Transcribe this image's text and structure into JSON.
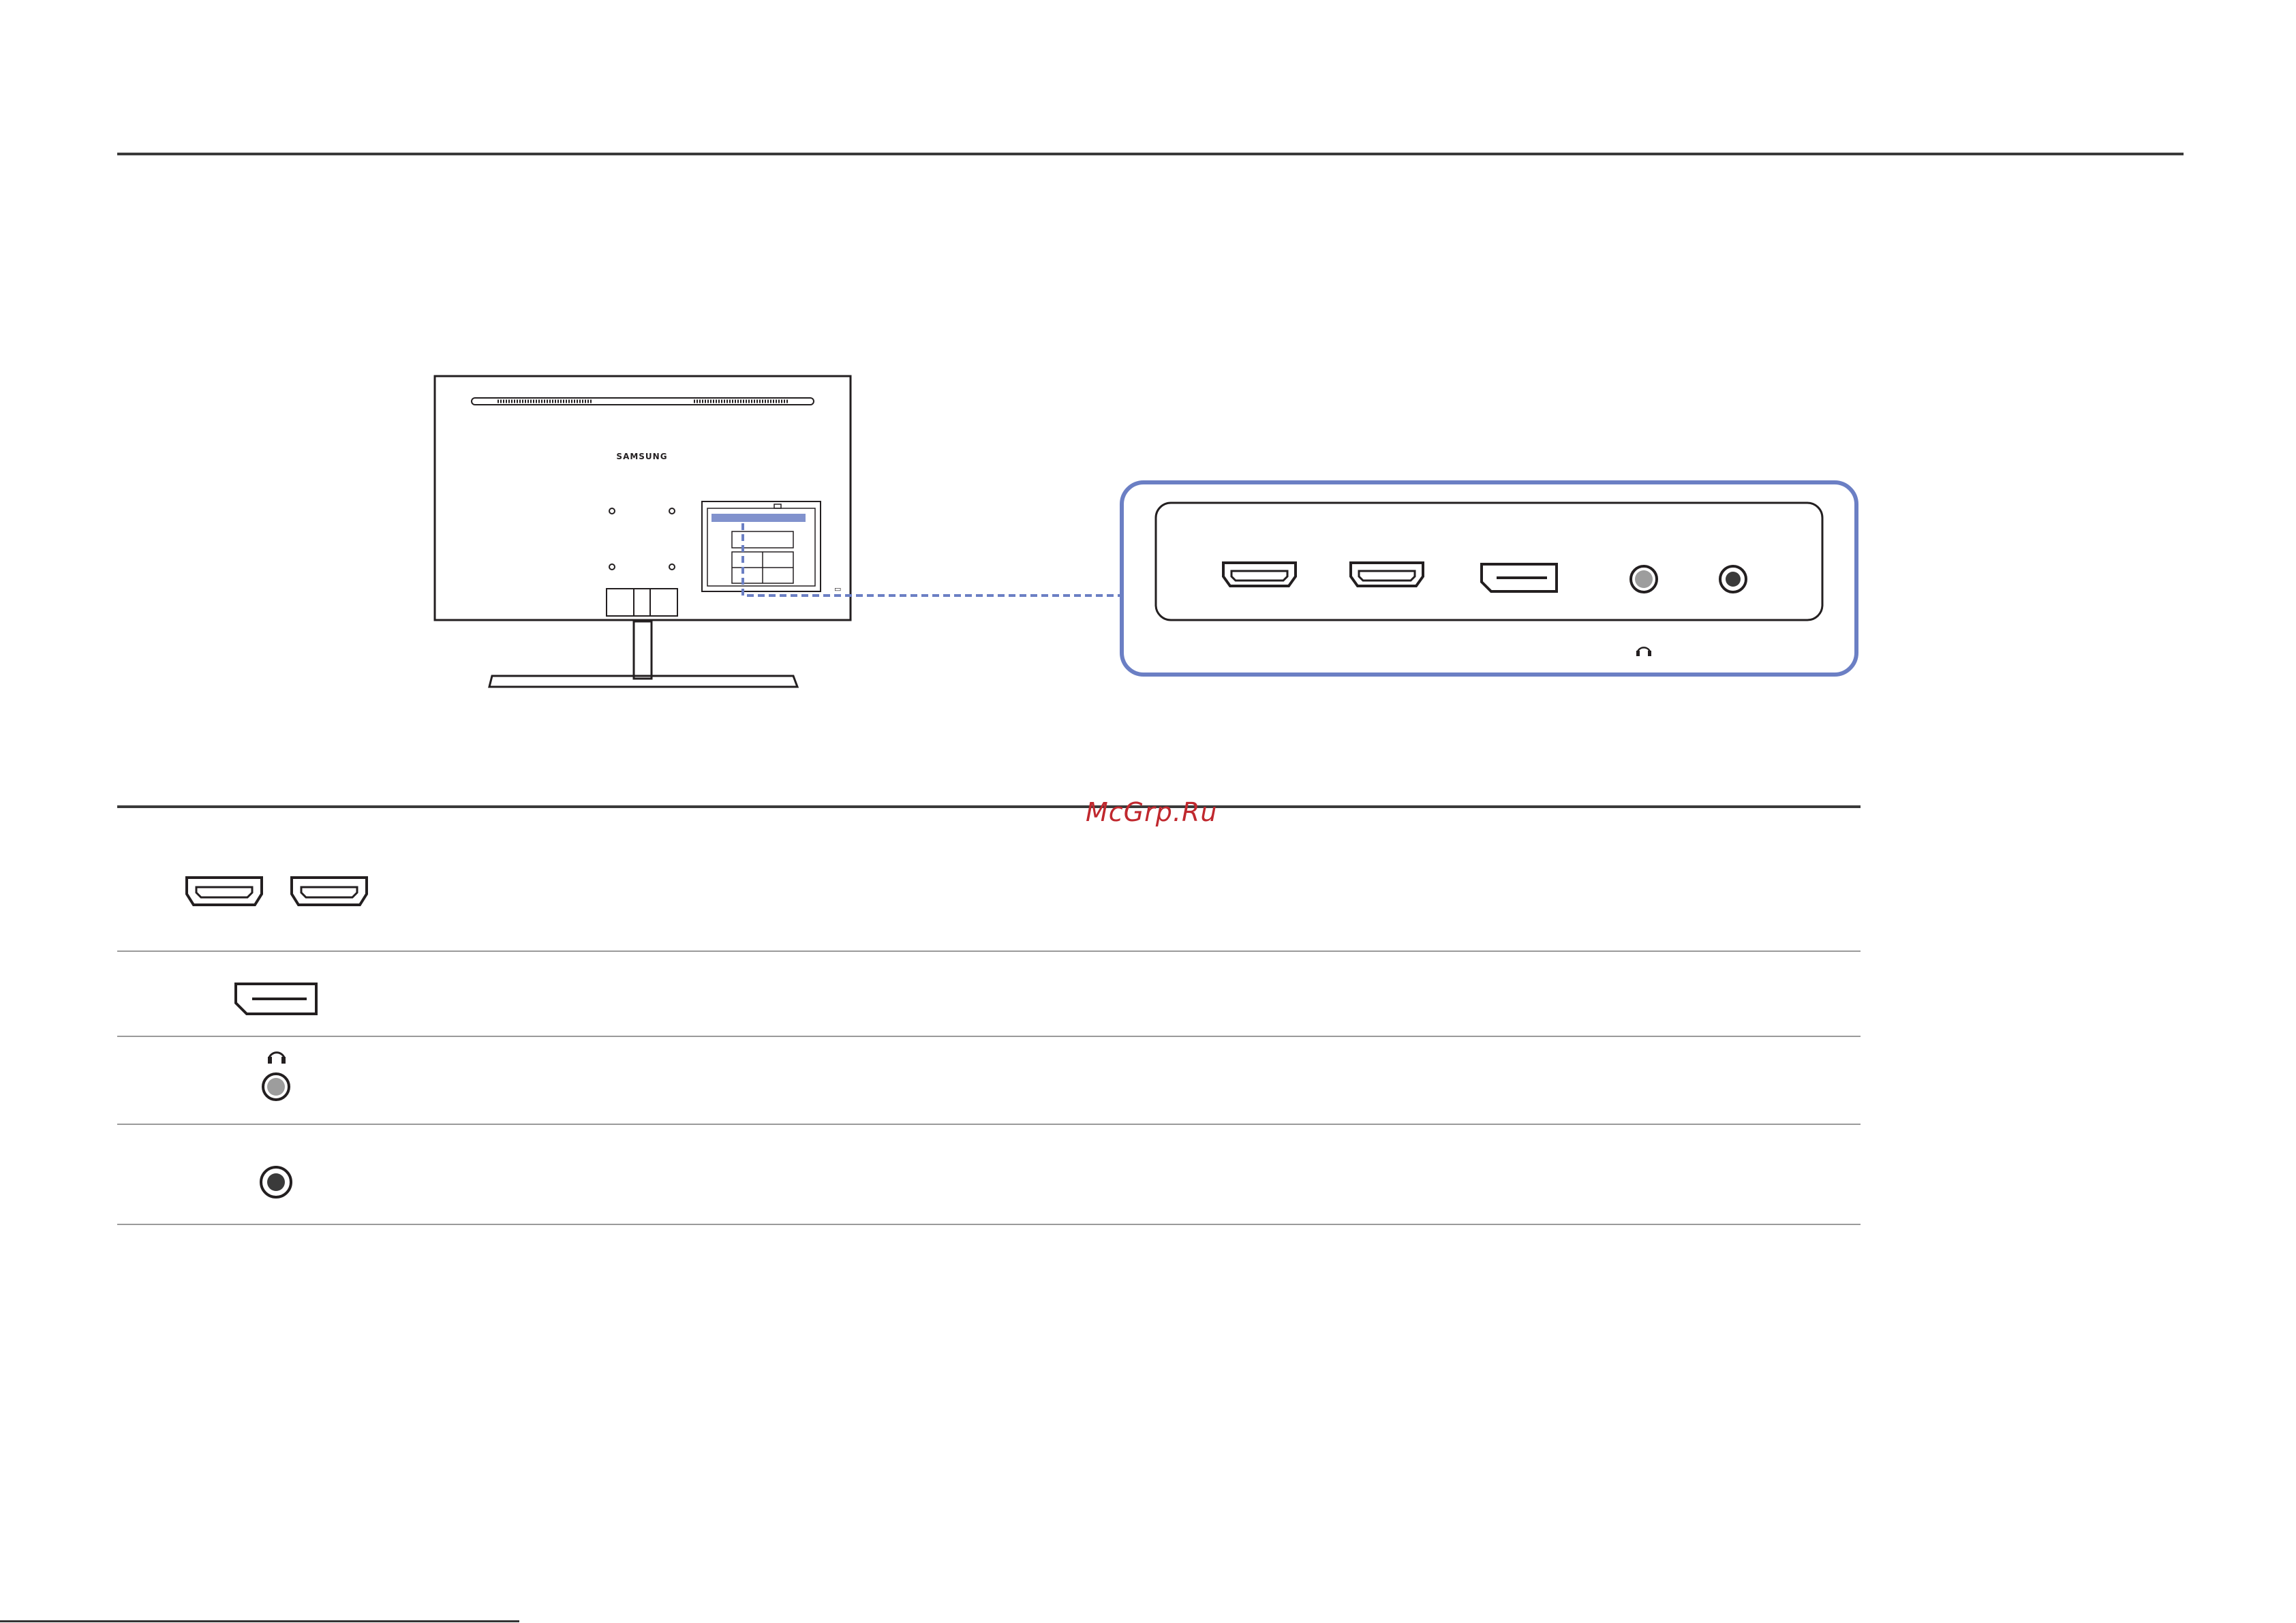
{
  "monitor": {
    "brand": "SAMSUNG"
  },
  "watermark": "McGrp.Ru",
  "port_panel": {
    "ports": [
      "hdmi-port-icon",
      "hdmi-port-icon",
      "displayport-icon",
      "headphone-jack-icon",
      "audio-in-jack-icon"
    ],
    "headphone_symbol": "headphone-icon"
  },
  "port_table": {
    "rows": [
      {
        "icons": [
          "hdmi-port-icon",
          "hdmi-port-icon"
        ]
      },
      {
        "icons": [
          "displayport-icon"
        ]
      },
      {
        "icons": [
          "headphone-icon",
          "headphone-jack-icon"
        ]
      },
      {
        "icons": [
          "audio-in-jack-icon"
        ]
      }
    ]
  },
  "colors": {
    "accent": "#6b7fc4",
    "line": "#231f20",
    "watermark": "#c0282e"
  }
}
